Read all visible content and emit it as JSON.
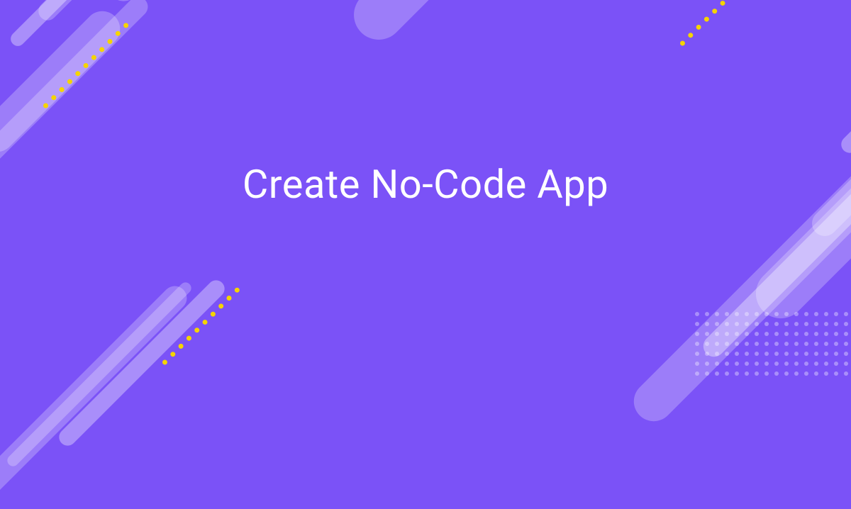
{
  "hero": {
    "title": "Create No-Code App"
  }
}
